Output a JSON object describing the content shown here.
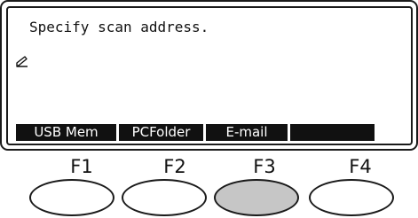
{
  "lcd": {
    "message": "Specify scan address.",
    "message_icon": "edit-pencil-icon"
  },
  "softkeys": [
    {
      "label": "USB Mem"
    },
    {
      "label": "PCFolder"
    },
    {
      "label": " E-mail "
    },
    {
      "label": ""
    }
  ],
  "function_keys": [
    {
      "label": "F1",
      "pressed": false
    },
    {
      "label": "F2",
      "pressed": false
    },
    {
      "label": "F3",
      "pressed": true
    },
    {
      "label": "F4",
      "pressed": false
    }
  ],
  "colors": {
    "pressed_button": "#c6c6c6",
    "softkey_background": "#111111",
    "softkey_text": "#ffffff"
  }
}
